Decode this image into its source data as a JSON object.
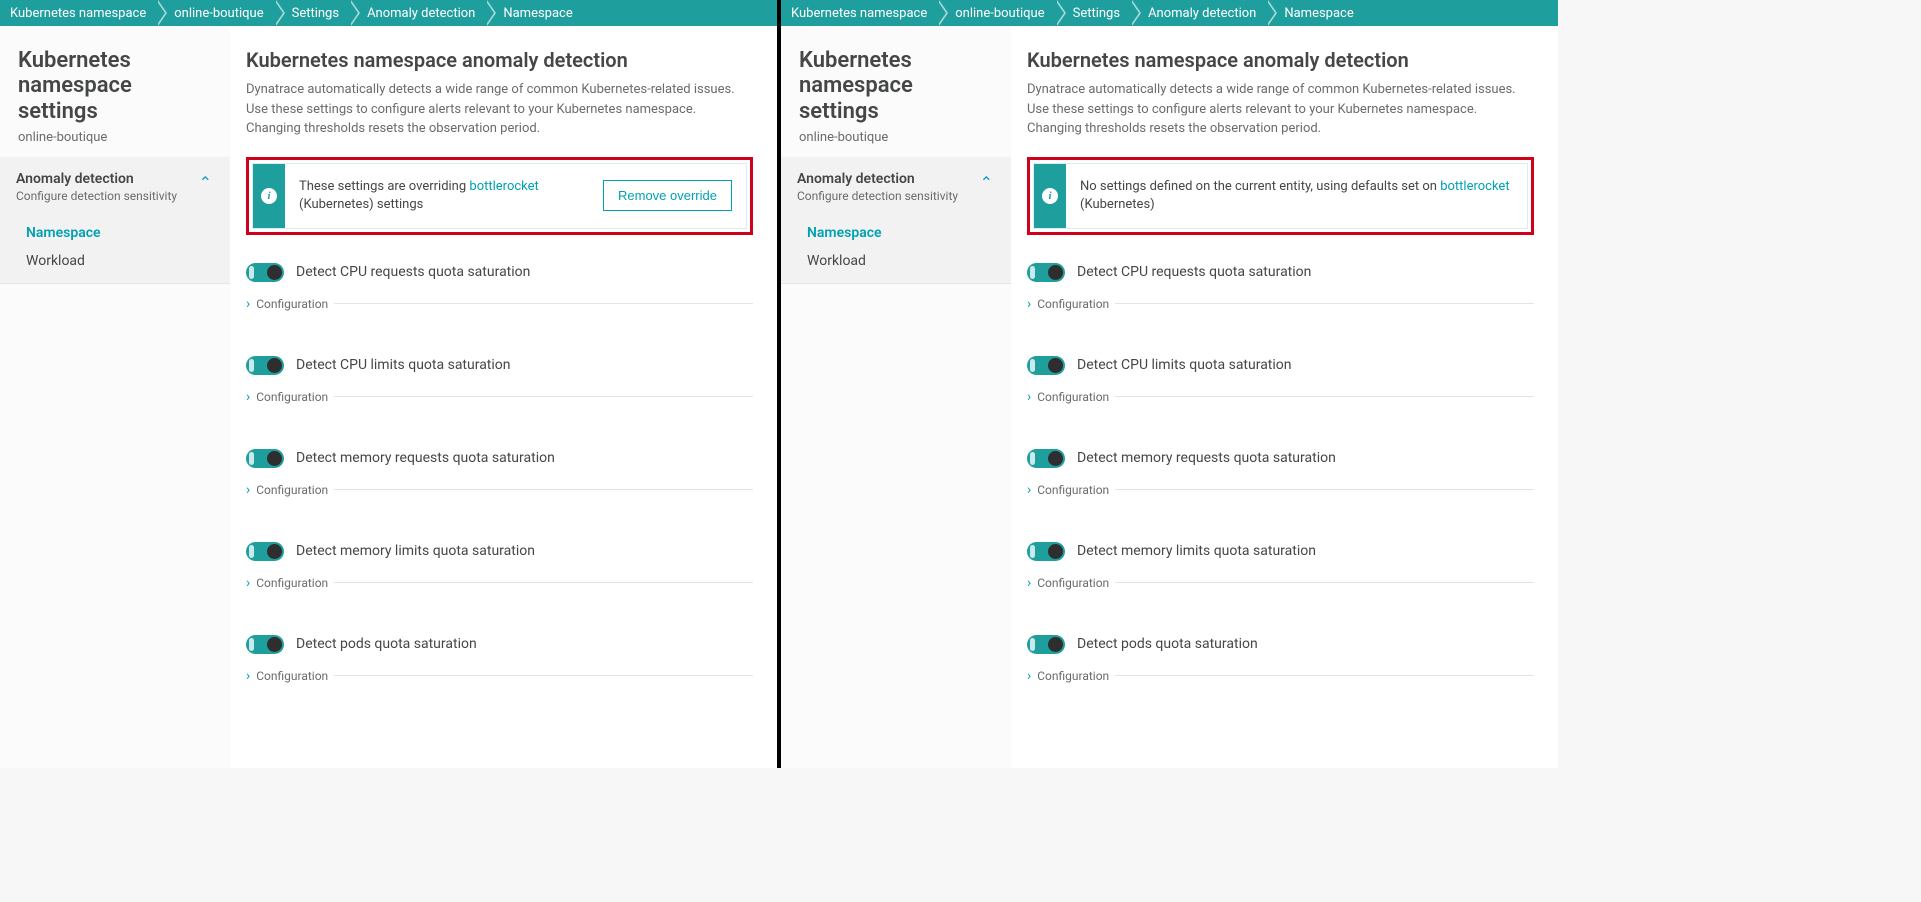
{
  "breadcrumbs": [
    "Kubernetes namespace",
    "online-boutique",
    "Settings",
    "Anomaly detection",
    "Namespace"
  ],
  "sidebar": {
    "title": "Kubernetes namespace settings",
    "subtitle": "online-boutique",
    "section_title": "Anomaly detection",
    "section_sub": "Configure detection sensitivity",
    "links": [
      "Namespace",
      "Workload"
    ]
  },
  "left_active_link_index": 0,
  "right_active_link_index": 0,
  "main": {
    "title": "Kubernetes namespace anomaly detection",
    "desc": "Dynatrace automatically detects a wide range of common Kubernetes-related issues. Use these settings to configure alerts relevant to your Kubernetes namespace. Changing thresholds resets the observation period."
  },
  "info_left": {
    "pre": "These settings are overriding ",
    "link": "bottlerocket",
    "post": " (Kubernetes) settings",
    "button": "Remove override"
  },
  "info_right": {
    "pre": "No settings defined on the current entity, using defaults set on ",
    "link": "bottlerocket",
    "post": " (Kubernetes)"
  },
  "detections": [
    "Detect CPU requests quota saturation",
    "Detect CPU limits quota saturation",
    "Detect memory requests quota saturation",
    "Detect memory limits quota saturation",
    "Detect pods quota saturation"
  ],
  "strings": {
    "configuration": "Configuration",
    "info_glyph": "i",
    "chev_right": "›",
    "chev_up": "⌃"
  }
}
